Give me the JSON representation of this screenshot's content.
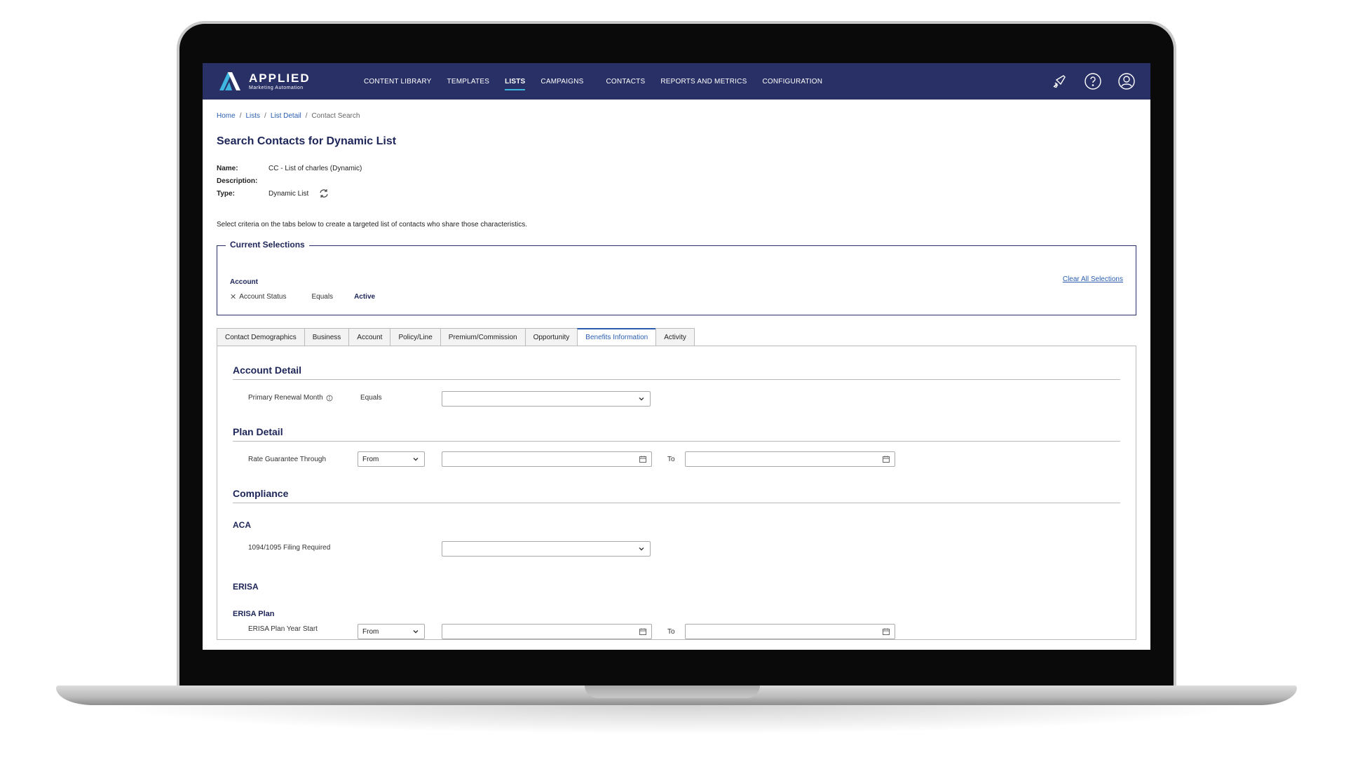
{
  "nav": {
    "logo_title": "APPLIED",
    "logo_sub": "Marketing Automation",
    "links": [
      {
        "label": "CONTENT LIBRARY",
        "active": false
      },
      {
        "label": "TEMPLATES",
        "active": false
      },
      {
        "label": "LISTS",
        "active": true
      },
      {
        "label": "CAMPAIGNS",
        "active": false
      },
      {
        "label": "CONTACTS",
        "active": false
      },
      {
        "label": "REPORTS AND METRICS",
        "active": false
      },
      {
        "label": "CONFIGURATION",
        "active": false
      }
    ],
    "icons": [
      "megaphone-icon",
      "help-icon",
      "user-icon"
    ]
  },
  "breadcrumb": {
    "home": "Home",
    "lists": "Lists",
    "list_detail": "List Detail",
    "current": "Contact Search",
    "separator": "/"
  },
  "page_title": "Search Contacts for Dynamic List",
  "meta": {
    "name_label": "Name:",
    "name_value": "CC - List of charles (Dynamic)",
    "description_label": "Description:",
    "description_value": "",
    "type_label": "Type:",
    "type_value": "Dynamic List"
  },
  "instructions": "Select criteria on the tabs below to create a targeted list of contacts who share those characteristics.",
  "selections": {
    "legend": "Current Selections",
    "group": "Account",
    "field": "Account Status",
    "operator": "Equals",
    "value": "Active",
    "clear_label": "Clear All Selections"
  },
  "tabs": [
    {
      "label": "Contact Demographics",
      "active": false
    },
    {
      "label": "Business",
      "active": false
    },
    {
      "label": "Account",
      "active": false
    },
    {
      "label": "Policy/Line",
      "active": false
    },
    {
      "label": "Premium/Commission",
      "active": false
    },
    {
      "label": "Opportunity",
      "active": false
    },
    {
      "label": "Benefits Information",
      "active": true
    },
    {
      "label": "Activity",
      "active": false
    }
  ],
  "panel": {
    "account_detail": {
      "title": "Account Detail",
      "field_label": "Primary Renewal Month",
      "operator": "Equals",
      "value": ""
    },
    "plan_detail": {
      "title": "Plan Detail",
      "field_label": "Rate Guarantee Through",
      "range_select": "From",
      "to_label": "To"
    },
    "compliance": {
      "title": "Compliance",
      "aca_title": "ACA",
      "aca_field": "1094/1095 Filing Required",
      "erisa_title": "ERISA",
      "erisa_plan_title": "ERISA Plan",
      "erisa_field": "ERISA Plan Year Start",
      "erisa_range_select": "From",
      "erisa_to_label": "To"
    }
  },
  "colors": {
    "nav_bg": "#283066",
    "accent": "#3fb6e0",
    "heading": "#1d2559",
    "link": "#2a5db0"
  }
}
